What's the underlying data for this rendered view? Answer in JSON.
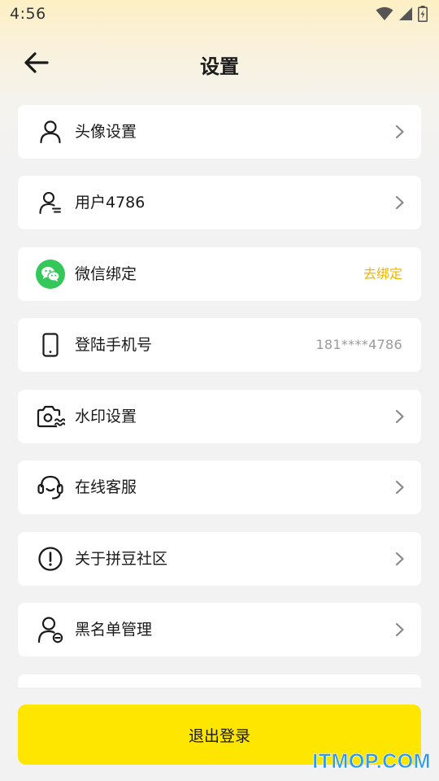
{
  "status_bar": {
    "time": "4:56"
  },
  "header": {
    "title": "设置"
  },
  "items": [
    {
      "label": "头像设置",
      "icon": "user-icon"
    },
    {
      "label": "用户4786",
      "icon": "user-edit-icon"
    },
    {
      "label": "微信绑定",
      "icon": "wechat-icon",
      "action": "去绑定"
    },
    {
      "label": "登陆手机号",
      "icon": "phone-icon",
      "value": "181****4786"
    },
    {
      "label": "水印设置",
      "icon": "camera-icon"
    },
    {
      "label": "在线客服",
      "icon": "headset-icon"
    },
    {
      "label": "关于拼豆社区",
      "icon": "info-icon"
    },
    {
      "label": "黑名单管理",
      "icon": "user-block-icon"
    }
  ],
  "logout_label": "退出登录",
  "watermark": "ITMOP.COM",
  "colors": {
    "accent": "#ffe600",
    "unbind": "#f2b400",
    "wechat": "#34c759"
  }
}
